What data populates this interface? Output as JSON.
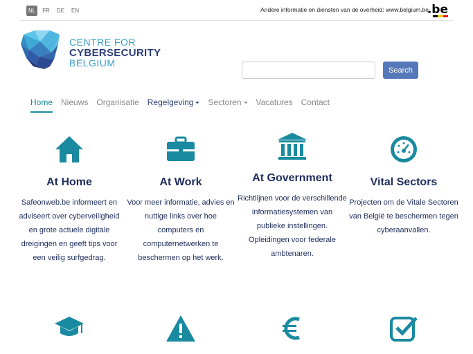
{
  "topbar": {
    "languages": [
      "NL",
      "FR",
      "DE",
      "EN"
    ],
    "active_language": "NL",
    "gov_text": "Andere informatie en diensten van de overheid: www.belgium.be",
    "be_logo": ".be"
  },
  "logo": {
    "line1": "CENTRE FOR",
    "line2": "CYBERSECURITY",
    "line3": "BELGIUM"
  },
  "search": {
    "placeholder": "",
    "value": "",
    "button_label": "Search"
  },
  "nav": {
    "items": [
      {
        "label": "Home",
        "active": true
      },
      {
        "label": "Nieuws"
      },
      {
        "label": "Organisatie"
      },
      {
        "label": "Regelgeving",
        "dropdown": true
      },
      {
        "label": "Sectoren",
        "dropdown": true
      },
      {
        "label": "Vacatures"
      },
      {
        "label": "Contact"
      }
    ]
  },
  "columns": [
    {
      "icon": "home-icon",
      "title": "At Home",
      "text": "Safeonweb.be informeert en adviseert over cyberveiligheid en grote actuele digitale dreigingen en geeft tips voor een veilig surfgedrag."
    },
    {
      "icon": "briefcase-icon",
      "title": "At Work",
      "text": "Voor meer informatie, advies en nuttige links over hoe computers en computernetwerken te beschermen op het werk."
    },
    {
      "icon": "bank-icon",
      "title": "At Government",
      "text": "Richtlijnen voor de verschillende informatiesystemen van publieke instellingen. Opleidingen voor federale ambtenaren."
    },
    {
      "icon": "dashboard-icon",
      "title": "Vital Sectors",
      "text": "Projecten om de Vitale Sectoren van België te beschermen tegen cyberaanvallen."
    }
  ],
  "row2_icons": [
    "graduation-cap-icon",
    "warning-icon",
    "euro-icon",
    "checkbox-icon"
  ],
  "colors": {
    "accent": "#1a8aa0",
    "navy": "#1e2d5e",
    "button": "#5677b9"
  }
}
